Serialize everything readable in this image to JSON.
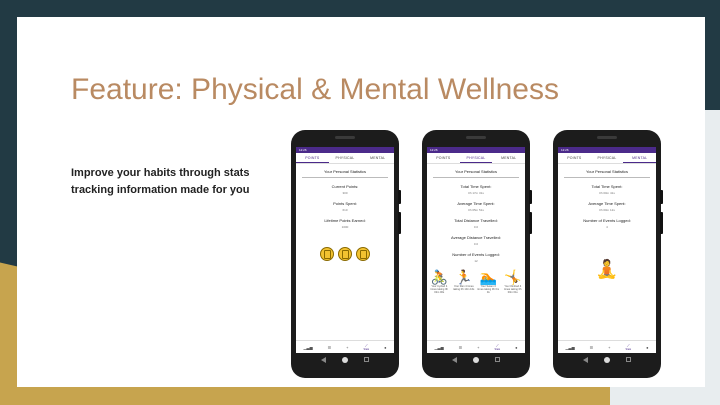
{
  "slide": {
    "title": "Feature: Physical & Mental Wellness",
    "tagline": "Improve your habits through stats tracking information made for you"
  },
  "app": {
    "status_time": "12:26",
    "tabs": [
      "POINTS",
      "PHYSICAL",
      "MENTAL"
    ],
    "header": "Your Personal Statistics",
    "nav": {
      "stats_label": "Stats"
    }
  },
  "phones": {
    "points": {
      "active_tab": "POINTS",
      "stats": [
        {
          "label": "Current Points:",
          "value": "300"
        },
        {
          "label": "Points Spent:",
          "value": "610"
        },
        {
          "label": "Lifetime Points Earned:",
          "value": "1000"
        }
      ],
      "coins": 3
    },
    "physical": {
      "active_tab": "PHYSICAL",
      "stats": [
        {
          "label": "Total Time Spent:",
          "value": "0h 17m 31s"
        },
        {
          "label": "Average Time Spent:",
          "value": "0h 05m 51s"
        },
        {
          "label": "Total Distance Travelled:",
          "value": "0.0"
        },
        {
          "label": "Average Distance Travelled:",
          "value": "0.0"
        },
        {
          "label": "Number of Events Logged:",
          "value": "12"
        }
      ],
      "activities": [
        {
          "icon": "cycling-icon",
          "glyph": "🚴",
          "caption": "Your Cycled 4 times taking 0h 02m 00s"
        },
        {
          "icon": "running-icon",
          "glyph": "🏃",
          "caption": "Your Ran 4 times taking 0h 10m 16s"
        },
        {
          "icon": "swimming-icon",
          "glyph": "🏊",
          "caption": "Your Swam 0 times taking 0h 0m 0s"
        },
        {
          "icon": "climbing-icon",
          "glyph": "🤸",
          "caption": "You Climbed 4 times taking 0h 00m 01s"
        }
      ]
    },
    "mental": {
      "active_tab": "MENTAL",
      "stats": [
        {
          "label": "Total Time Spent:",
          "value": "0h 00m 41s"
        },
        {
          "label": "Average Time Spent:",
          "value": "0h 00m 12s"
        },
        {
          "label": "Number of Events Logged:",
          "value": "4"
        }
      ],
      "icon": "meditation-icon",
      "glyph": "🧘"
    }
  },
  "colors": {
    "title": "#b98a62",
    "accent": "#4b2a8a",
    "background_dark": "#223a44",
    "background_gold": "#c7a44e",
    "coin": "#f2c230"
  }
}
